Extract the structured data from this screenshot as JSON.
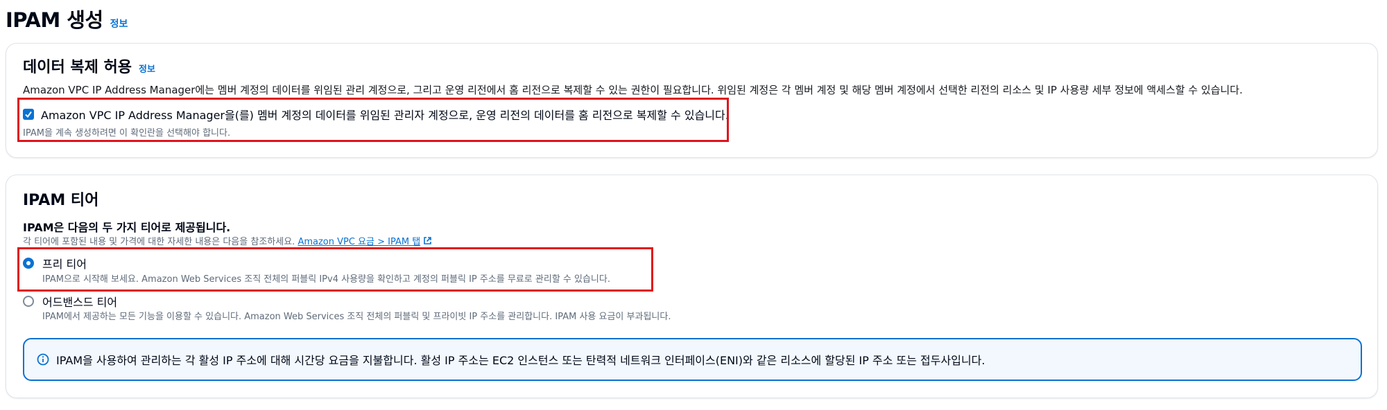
{
  "header": {
    "title": "IPAM 생성",
    "info_link": "정보"
  },
  "replication": {
    "title": "데이터 복제 허용",
    "info_link": "정보",
    "description": "Amazon VPC IP Address Manager에는 멤버 계정의 데이터를 위임된 관리 계정으로, 그리고 운영 리전에서 홈 리전으로 복제할 수 있는 권한이 필요합니다. 위임된 계정은 각 멤버 계정 및 해당 멤버 계정에서 선택한 리전의 리소스 및 IP 사용량 세부 정보에 액세스할 수 있습니다.",
    "checkbox_label": "Amazon VPC IP Address Manager을(를) 멤버 계정의 데이터를 위임된 관리자 계정으로, 운영 리전의 데이터를 홈 리전으로 복제할 수 있습니다.",
    "checkbox_checked": true,
    "checkbox_hint": "IPAM을 계속 생성하려면 이 확인란을 선택해야 합니다."
  },
  "tier": {
    "title": "IPAM 티어",
    "subheading": "IPAM은 다음의 두 가지 티어로 제공됩니다.",
    "pricing_prefix": "각 티어에 포함된 내용 및 가격에 대한 자세한 내용은 다음을 참조하세요.",
    "pricing_link": "Amazon VPC 요금 > IPAM 탭",
    "options": [
      {
        "label": "프리 티어",
        "description": "IPAM으로 시작해 보세요. Amazon Web Services 조직 전체의 퍼블릭 IPv4 사용량을 확인하고 계정의 퍼블릭 IP 주소를 무료로 관리할 수 있습니다.",
        "selected": true
      },
      {
        "label": "어드밴스드 티어",
        "description": "IPAM에서 제공하는 모든 기능을 이용할 수 있습니다. Amazon Web Services 조직 전체의 퍼블릭 및 프라이빗 IP 주소를 관리합니다. IPAM 사용 요금이 부과됩니다.",
        "selected": false
      }
    ],
    "alert_text": "IPAM을 사용하여 관리하는 각 활성 IP 주소에 대해 시간당 요금을 지불합니다. 활성 IP 주소는 EC2 인스턴스 또는 탄력적 네트워크 인터페이스(ENI)와 같은 리소스에 할당된 IP 주소 또는 접두사입니다."
  },
  "colors": {
    "accent": "#0972d3",
    "highlight": "#e0131c",
    "alert_bg": "#f2f8fd"
  }
}
